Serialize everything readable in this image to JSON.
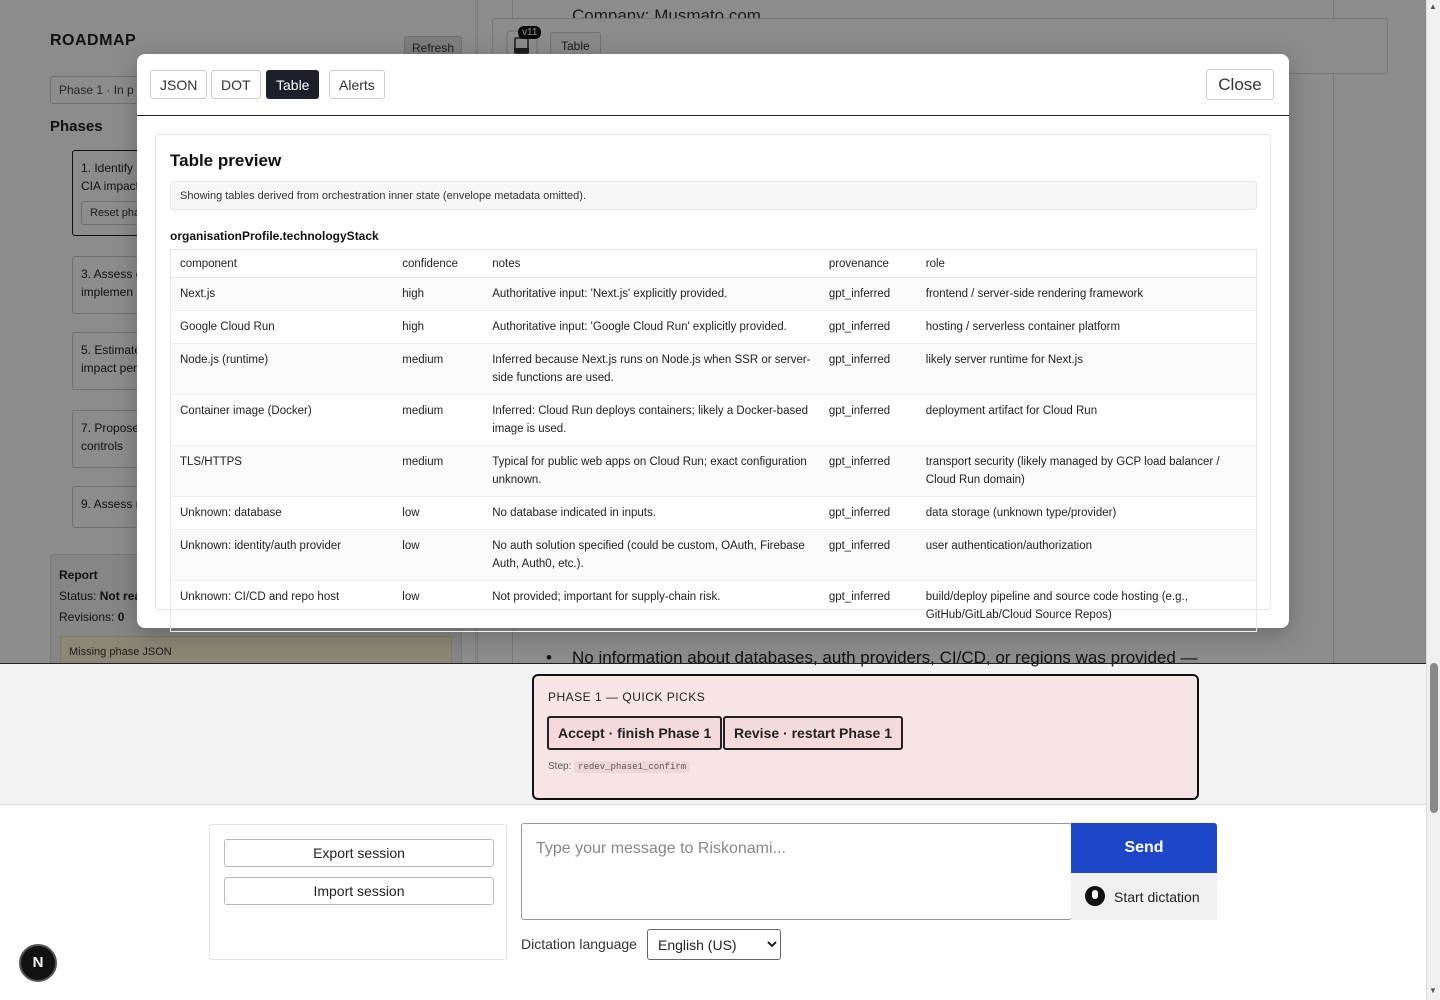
{
  "sidebar": {
    "title": "ROADMAP",
    "refresh_label": "Refresh",
    "phase_row": "Phase 1  ·  In p",
    "phases_heading": "Phases",
    "phase_cards": [
      {
        "label": "1. Identify\nCIA impact",
        "reset": "Reset pha"
      },
      {
        "label": "3. Assess c\nimplemen"
      },
      {
        "label": "5. Estimate\nimpact per"
      },
      {
        "label": "7. Propose\ncontrols"
      },
      {
        "label": "9. Assess r"
      }
    ],
    "report": {
      "title": "Report",
      "status_label": "Status:",
      "status_value": "Not rea",
      "revisions_label": "Revisions:",
      "revisions_value": "0"
    },
    "missing": "Missing phase JSON"
  },
  "main": {
    "top_text": "Company: Musmato.com",
    "version": "v11",
    "table_tab": "Table",
    "bullet_text": "No information about databases, auth providers, CI/CD, or regions was provided —"
  },
  "modal": {
    "tabs": [
      "JSON",
      "DOT",
      "Table",
      "Alerts"
    ],
    "active_tab": "Table",
    "close_label": "Close",
    "preview_title": "Table preview",
    "info": "Showing tables derived from orchestration inner state (envelope metadata omitted).",
    "section": "organisationProfile.technologyStack",
    "columns": [
      "component",
      "confidence",
      "notes",
      "provenance",
      "role"
    ],
    "rows": [
      [
        "Next.js",
        "high",
        "Authoritative input: 'Next.js' explicitly provided.",
        "gpt_inferred",
        "frontend / server-side rendering framework"
      ],
      [
        "Google Cloud Run",
        "high",
        "Authoritative input: 'Google Cloud Run' explicitly provided.",
        "gpt_inferred",
        "hosting / serverless container platform"
      ],
      [
        "Node.js (runtime)",
        "medium",
        "Inferred because Next.js runs on Node.js when SSR or server-side functions are used.",
        "gpt_inferred",
        "likely server runtime for Next.js"
      ],
      [
        "Container image (Docker)",
        "medium",
        "Inferred: Cloud Run deploys containers; likely a Docker-based image is used.",
        "gpt_inferred",
        "deployment artifact for Cloud Run"
      ],
      [
        "TLS/HTTPS",
        "medium",
        "Typical for public web apps on Cloud Run; exact configuration unknown.",
        "gpt_inferred",
        "transport security (likely managed by GCP load balancer / Cloud Run domain)"
      ],
      [
        "Unknown: database",
        "low",
        "No database indicated in inputs.",
        "gpt_inferred",
        "data storage (unknown type/provider)"
      ],
      [
        "Unknown: identity/auth provider",
        "low",
        "No auth solution specified (could be custom, OAuth, Firebase Auth, Auth0, etc.).",
        "gpt_inferred",
        "user authentication/authorization"
      ],
      [
        "Unknown: CI/CD and repo host",
        "low",
        "Not provided; important for supply-chain risk.",
        "gpt_inferred",
        "build/deploy pipeline and source code hosting (e.g., GitHub/GitLab/Cloud Source Repos)"
      ]
    ]
  },
  "quick_picks": {
    "title": "PHASE 1 — QUICK PICKS",
    "accept_label": "Accept · finish Phase 1",
    "revise_label": "Revise · restart Phase 1",
    "step_label": "Step:",
    "step_code": "redev_phase1_confirm"
  },
  "footer": {
    "export_label": "Export session",
    "import_label": "Import session",
    "message_placeholder": "Type your message to Riskonami...",
    "send_label": "Send",
    "dictation_label": "Start dictation",
    "language_label": "Dictation language",
    "language_value": "English (US)"
  },
  "badge": "N",
  "colors": {
    "accent": "#1e47c8",
    "active_tab": "#1d1f2b",
    "quick_bg": "#f7e4e4",
    "missing_bg": "#fdf6d8"
  }
}
